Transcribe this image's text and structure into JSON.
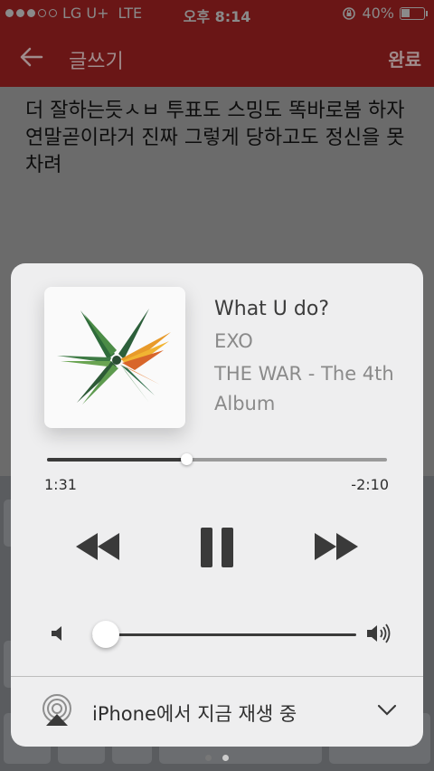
{
  "status_bar": {
    "carrier": "LG U+",
    "network": "LTE",
    "time": "오후 8:14",
    "battery": "40%",
    "battery_level": 0.4
  },
  "header": {
    "title": "글쓰기",
    "done_label": "완료"
  },
  "post": {
    "text": "더 잘하는듯ㅅㅂ 투표도 스밍도 똑바로봄 하자 연말곧이라거 진짜 그렇게 당하고도 정신을 못차려"
  },
  "now_playing": {
    "song": "What U do?",
    "artist": "EXO",
    "album": "THE WAR - The 4th Album",
    "elapsed": "1:31",
    "remaining": "-2:10",
    "progress": 0.41,
    "volume": 0.05,
    "playback_state": "playing",
    "route": "iPhone에서 지금 재생 중"
  },
  "keyboard": {
    "page_indicator_count": 2,
    "page_indicator_active": 2
  },
  "colors": {
    "header_bg": "#6a1616",
    "card_bg": "#eeeeef",
    "text_dark": "#2e2e2e",
    "text_muted": "#8a8a8a"
  },
  "icons": [
    "back-arrow-icon",
    "lock-rotation-icon",
    "battery-icon",
    "album-art",
    "rewind-icon",
    "pause-icon",
    "fast-forward-icon",
    "volume-min-icon",
    "volume-max-icon",
    "airplay-icon",
    "chevron-down-icon"
  ]
}
